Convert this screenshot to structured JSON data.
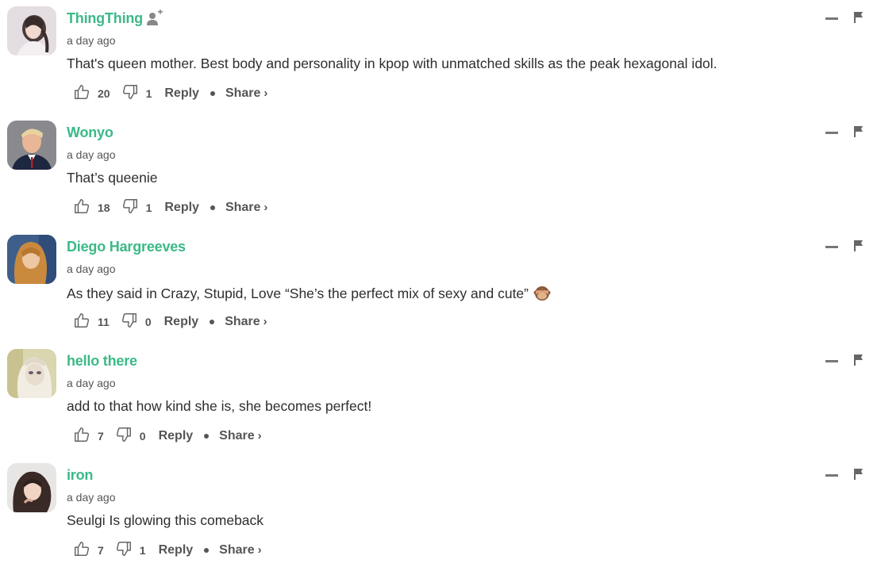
{
  "comments": [
    {
      "username": "ThingThing",
      "show_follow": true,
      "timestamp": "a day ago",
      "text": "That's queen mother. Best body and personality in kpop with unmatched skills as the peak hexagonal idol.",
      "emoji": "",
      "upvotes": "20",
      "downvotes": "1",
      "reply_label": "Reply",
      "share_label": "Share",
      "share_chevron": "›",
      "avatar": "avatar-woman-light"
    },
    {
      "username": "Wonyo",
      "show_follow": false,
      "timestamp": "a day ago",
      "text": "That’s queenie",
      "emoji": "",
      "upvotes": "18",
      "downvotes": "1",
      "reply_label": "Reply",
      "share_label": "Share",
      "share_chevron": "›",
      "avatar": "avatar-man-suit"
    },
    {
      "username": "Diego Hargreeves",
      "show_follow": false,
      "timestamp": "a day ago",
      "text": "As they said in Crazy, Stupid, Love “She’s the perfect mix of sexy and cute”",
      "emoji": "see-no-evil-monkey",
      "upvotes": "11",
      "downvotes": "0",
      "reply_label": "Reply",
      "share_label": "Share",
      "share_chevron": "›",
      "avatar": "avatar-redhead"
    },
    {
      "username": "hello there",
      "show_follow": false,
      "timestamp": "a day ago",
      "text": "add to that how kind she is, she becomes perfect!",
      "emoji": "",
      "upvotes": "7",
      "downvotes": "0",
      "reply_label": "Reply",
      "share_label": "Share",
      "share_chevron": "›",
      "avatar": "avatar-anime"
    },
    {
      "username": "iron",
      "show_follow": false,
      "timestamp": "a day ago",
      "text": "Seulgi Is glowing this comeback",
      "emoji": "",
      "upvotes": "7",
      "downvotes": "1",
      "reply_label": "Reply",
      "share_label": "Share",
      "share_chevron": "›",
      "avatar": "avatar-woman-dark"
    }
  ],
  "colors": {
    "username": "#3bb987",
    "muted": "#555555",
    "text": "#2e2e2e",
    "icon": "#777777"
  },
  "icons": {
    "upvote": "thumbs-up-icon",
    "downvote": "thumbs-down-icon",
    "collapse": "minus-icon",
    "flag": "flag-icon",
    "follow": "add-user-icon"
  }
}
